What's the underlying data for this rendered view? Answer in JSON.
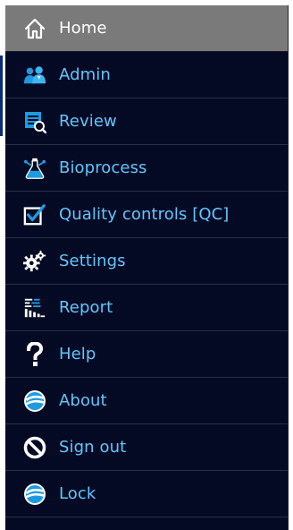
{
  "menu": {
    "items": [
      {
        "label": "Home",
        "icon": "home-icon"
      },
      {
        "label": "Admin",
        "icon": "users-icon"
      },
      {
        "label": "Review",
        "icon": "review-icon"
      },
      {
        "label": "Bioprocess",
        "icon": "flask-icon"
      },
      {
        "label": "Quality controls [QC]",
        "icon": "checkbox-icon"
      },
      {
        "label": "Settings",
        "icon": "gears-icon"
      },
      {
        "label": "Report",
        "icon": "report-icon"
      },
      {
        "label": "Help",
        "icon": "question-icon"
      },
      {
        "label": "About",
        "icon": "about-logo-icon"
      },
      {
        "label": "Sign out",
        "icon": "no-entry-icon"
      },
      {
        "label": "Lock",
        "icon": "lock-logo-icon"
      }
    ],
    "active_index": 0
  },
  "colors": {
    "background": "#040a24",
    "active_background": "#7a7a7a",
    "label": "#5fc8ff",
    "active_label": "#ffffff",
    "icon_blue": "#1e9be0",
    "icon_white": "#ffffff"
  }
}
